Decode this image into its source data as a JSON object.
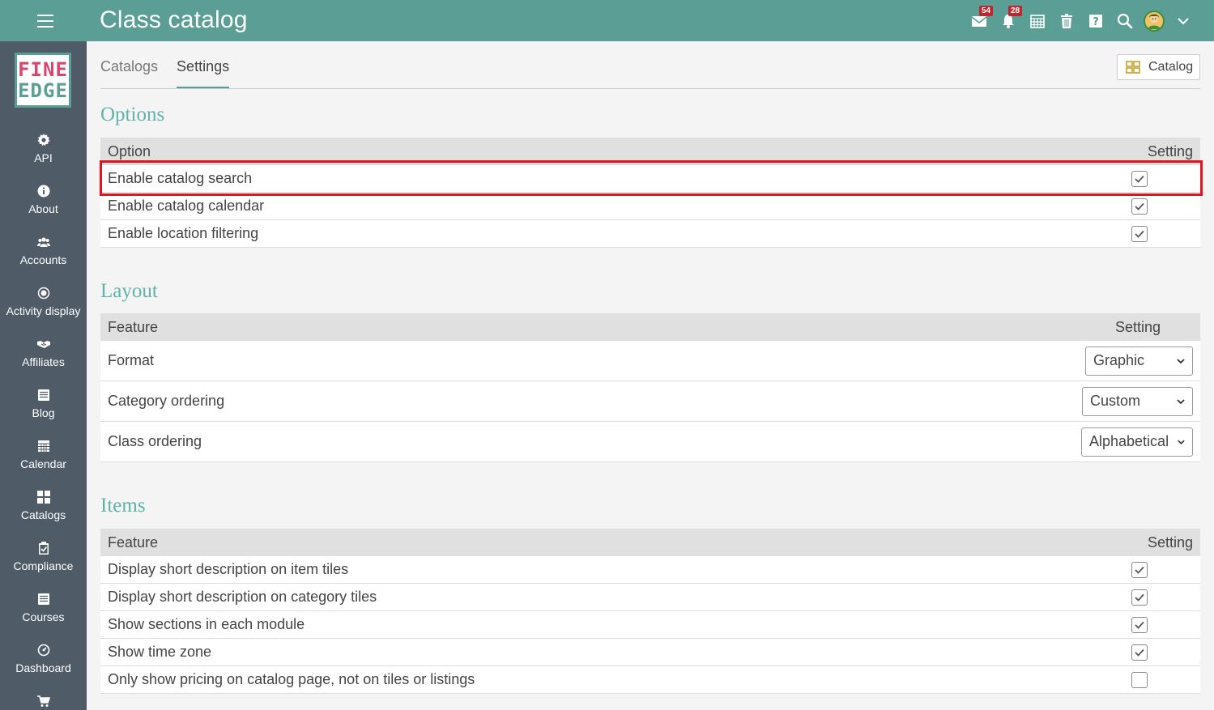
{
  "header": {
    "title": "Class catalog",
    "badges": {
      "messages": "54",
      "notifications": "28"
    },
    "icons": [
      "menu-icon",
      "mail-icon",
      "bell-icon",
      "calendar-icon",
      "trash-icon",
      "help-icon",
      "search-icon",
      "avatar",
      "chevron-down-icon"
    ]
  },
  "sidebar": {
    "logo": {
      "line1": "FINE",
      "line2": "EDGE"
    },
    "items": [
      {
        "label": "API",
        "icon": "gear-icon"
      },
      {
        "label": "About",
        "icon": "info-icon"
      },
      {
        "label": "Accounts",
        "icon": "users-icon"
      },
      {
        "label": "Activity display",
        "icon": "dot-icon"
      },
      {
        "label": "Affiliates",
        "icon": "handshake-icon"
      },
      {
        "label": "Blog",
        "icon": "list-icon"
      },
      {
        "label": "Calendar",
        "icon": "calendar-icon"
      },
      {
        "label": "Catalogs",
        "icon": "grid-icon"
      },
      {
        "label": "Compliance",
        "icon": "clipboard-check-icon"
      },
      {
        "label": "Courses",
        "icon": "list-icon"
      },
      {
        "label": "Dashboard",
        "icon": "gauge-icon"
      },
      {
        "label": "",
        "icon": "cart-icon"
      }
    ]
  },
  "tabs": [
    {
      "label": "Catalogs",
      "active": false
    },
    {
      "label": "Settings",
      "active": true
    }
  ],
  "catalog_button": {
    "label": "Catalog",
    "icon": "grid-icon"
  },
  "options": {
    "title": "Options",
    "col1": "Option",
    "col2": "Setting",
    "rows": [
      {
        "label": "Enable catalog search",
        "checked": true
      },
      {
        "label": "Enable catalog calendar",
        "checked": true
      },
      {
        "label": "Enable location filtering",
        "checked": true
      }
    ]
  },
  "layout": {
    "title": "Layout",
    "col1": "Feature",
    "col2": "Setting",
    "rows": [
      {
        "label": "Format",
        "value": "Graphic"
      },
      {
        "label": "Category ordering",
        "value": "Custom"
      },
      {
        "label": "Class ordering",
        "value": "Alphabetical"
      }
    ]
  },
  "items": {
    "title": "Items",
    "col1": "Feature",
    "col2": "Setting",
    "rows": [
      {
        "label": "Display short description on item tiles",
        "checked": true
      },
      {
        "label": "Display short description on category tiles",
        "checked": true
      },
      {
        "label": "Show sections in each module",
        "checked": true
      },
      {
        "label": "Show time zone",
        "checked": true
      },
      {
        "label": "Only show pricing on catalog page, not on tiles or listings",
        "checked": false
      }
    ]
  },
  "colors": {
    "topbar": "#5b9e96",
    "sidebar": "#4f5b66",
    "accent": "#5fb3aa",
    "highlight": "#e8121c"
  }
}
